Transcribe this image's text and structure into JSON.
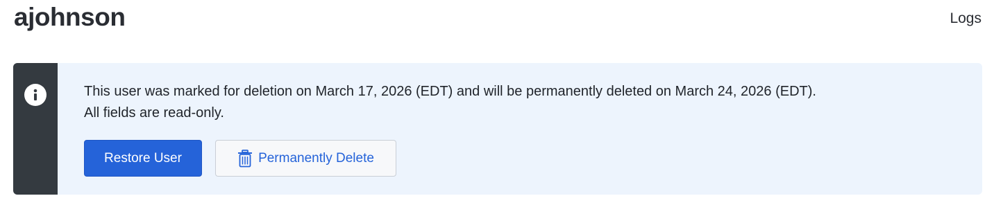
{
  "header": {
    "title": "ajohnson",
    "logs_link": "Logs"
  },
  "banner": {
    "message_line1": "This user was marked for deletion on March 17, 2026 (EDT) and will be permanently deleted on March 24, 2026 (EDT).",
    "message_line2": "All fields are read-only.",
    "icon": "info-icon",
    "restore_label": "Restore User",
    "delete_label": "Permanently Delete",
    "delete_icon": "trash-icon"
  },
  "colors": {
    "banner_background": "#edf4fd",
    "rail": "#343a40",
    "primary": "#2563d9"
  }
}
